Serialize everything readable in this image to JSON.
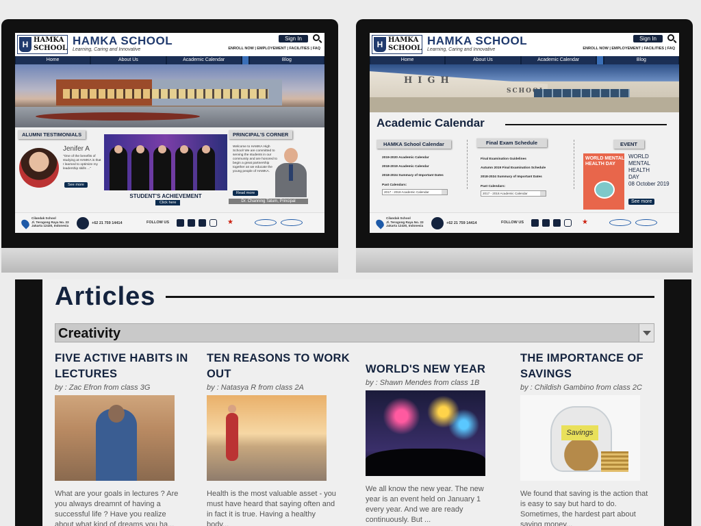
{
  "home": {
    "brand": {
      "logo_line1": "HAMKA",
      "logo_line2": "SCHOOL",
      "shield": "H",
      "title": "HAMKA SCHOOL",
      "tagline": "Learning, Caring and Innovative"
    },
    "signin": "Sign In",
    "toplinks": "ENROLL NOW | EMPLOYEMENT | FACILITIES | FAQ",
    "nav": [
      "Home",
      "About Us",
      "Academic Calendar",
      "Blog"
    ],
    "alumni": {
      "heading": "ALUMNI TESTIMONIALS",
      "name": "Jenifer A",
      "quote": "\"One of the benefits of studying at HAMKA is that I learned to optimize my leadership skills ...\"",
      "see_more": "See more"
    },
    "achievement": {
      "label": "STUDENT'S ACHIEVEMENT",
      "click": "Click here"
    },
    "principal": {
      "heading": "PRINCIPAL'S CORNER",
      "text": "Welcome to HAMKA High School! We are committed to serving the students in our community and are honored to begin a great partnership together as we educate the young people of HAMKA.",
      "read_more": "Read more",
      "name": "Dr. Channing Tatum, Principal"
    },
    "footer": {
      "addr1": "Cilandak School",
      "addr2": "Jl. Terogong Raya No. 33",
      "addr3": "Jakarta 12430, Indonesia",
      "phone": "+62 21 759 14414",
      "follow": "FOLLOW US"
    }
  },
  "academic": {
    "title": "Academic Calendar",
    "col1": {
      "heading": "HAMKA School Calendar",
      "items": [
        "2019-2020 Academic Calendar",
        "2018-2019 Academic Calendar",
        "2018-2024 Summary of Important Dates"
      ],
      "past": "Past Calendars:",
      "select": "2017 - 2018 Academic Calendar"
    },
    "col2": {
      "heading": "Final Exam Schedule",
      "items": [
        "Final Examination Guidelines",
        "Autumn 2019 Final Examination Schedule",
        "2018-2024 Summary of Important Dates"
      ],
      "past": "Past Calendars:",
      "select": "2017 - 2018 Academic Calendar"
    },
    "event": {
      "heading": "EVENT",
      "poster": "WORLD MENTAL HEALTH DAY",
      "text1": "WORLD",
      "text2": "MENTAL",
      "text3": "HEALTH",
      "text4": "DAY",
      "date": "08 October 2019",
      "see_more": "See more"
    }
  },
  "articles": {
    "title": "Articles",
    "category": "Creativity",
    "cards": [
      {
        "title": "FIVE ACTIVE HABITS IN LECTURES",
        "by": "by : Zac Efron from class 3G",
        "excerpt": "What are your goals in lectures ? Are you always dreamnt of having a successful life ? Have you realize about what kind of dreams you ha..."
      },
      {
        "title": "TEN REASONS TO WORK OUT",
        "by": "by : Natasya R from class 2A",
        "excerpt": "Health is the most valuable asset - you must have heard that saying often and in fact it is true. Having a healthy body..."
      },
      {
        "title": "WORLD'S NEW YEAR",
        "by": "by : Shawn Mendes from class 1B",
        "excerpt": "We all know the new year. The new year is an event held on January 1 every year. And we are ready continuously. But ..."
      },
      {
        "title": "THE IMPORTANCE OF SAVINGS",
        "by": "by : Childish Gambino from class 2C",
        "excerpt": "We found that saving is the action that is easy to say but hard to do. Sometimes, the hardest part about saving money..."
      }
    ],
    "savings_label": "Savings"
  }
}
